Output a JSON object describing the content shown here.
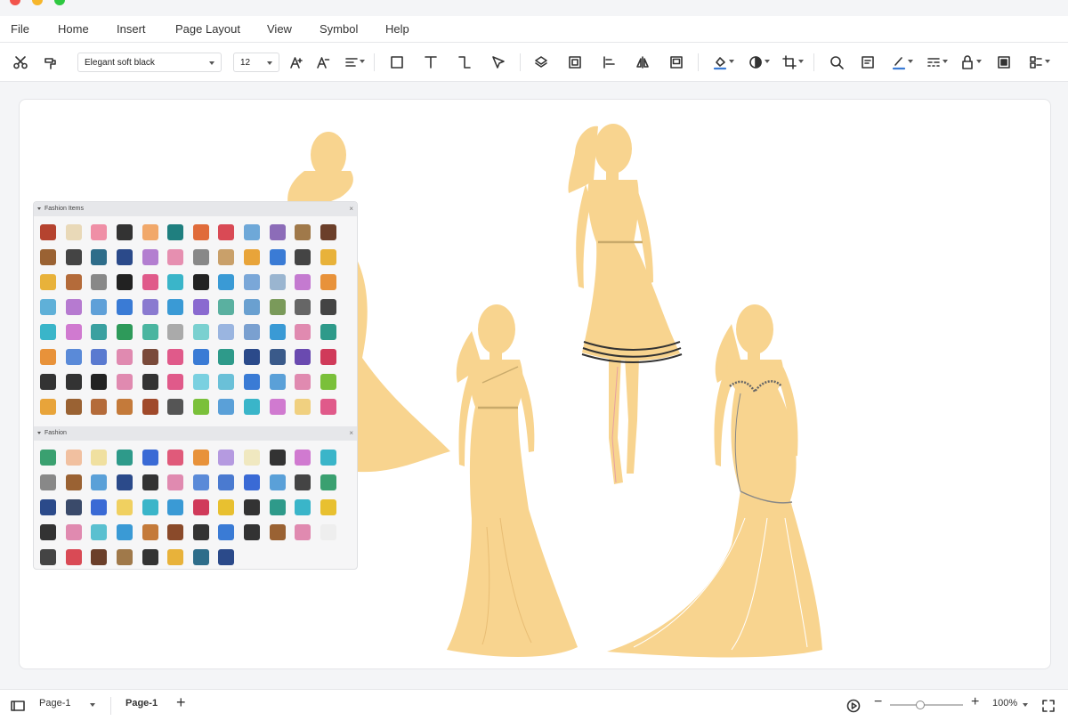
{
  "menu": [
    "File",
    "Home",
    "Insert",
    "Page Layout",
    "View",
    "Symbol",
    "Help"
  ],
  "toolbar": {
    "font_family": "Elegant soft black",
    "font_size": "12",
    "icons": [
      "scissors-icon",
      "format-painter-icon",
      "font-increase-icon",
      "font-decrease-icon",
      "align-icon",
      "rectangle-icon",
      "text-icon",
      "connector-icon",
      "pointer-icon",
      "layers-icon",
      "group-icon",
      "align-left-icon",
      "flip-icon",
      "frame-icon",
      "fill-icon",
      "shape-style-icon",
      "crop-icon",
      "search-icon",
      "image-icon",
      "line-color-icon",
      "line-style-icon",
      "lock-icon",
      "fit-icon",
      "more-icon"
    ]
  },
  "library": {
    "sections": [
      {
        "title": "Fashion Items"
      },
      {
        "title": "Fashion"
      }
    ]
  },
  "status": {
    "page_selector": "Page-1",
    "page_tab": "Page-1",
    "add_page": "+",
    "zoom": "100%",
    "zoom_minus": "−",
    "zoom_plus": "+",
    "zoom_fraction": 0.42
  },
  "colors": {
    "silhouette": "#f8d48f",
    "accent": "#3a7bd5"
  }
}
